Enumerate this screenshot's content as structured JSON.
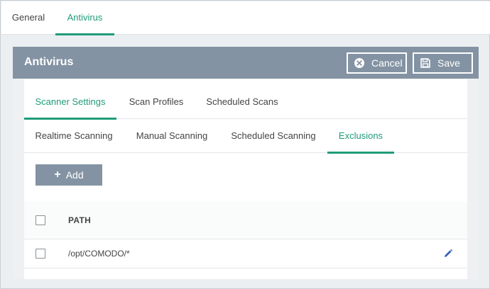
{
  "top_tabs": [
    {
      "label": "General",
      "active": false
    },
    {
      "label": "Antivirus",
      "active": true
    }
  ],
  "panel": {
    "title": "Antivirus",
    "cancel_label": "Cancel",
    "save_label": "Save"
  },
  "main_tabs": [
    {
      "label": "Scanner Settings",
      "active": true
    },
    {
      "label": "Scan Profiles",
      "active": false
    },
    {
      "label": "Scheduled Scans",
      "active": false
    }
  ],
  "sub_tabs": [
    {
      "label": "Realtime Scanning",
      "active": false
    },
    {
      "label": "Manual Scanning",
      "active": false
    },
    {
      "label": "Scheduled Scanning",
      "active": false
    },
    {
      "label": "Exclusions",
      "active": true
    }
  ],
  "add_label": "Add",
  "table": {
    "header_path": "PATH",
    "rows": [
      {
        "path": "/opt/COMODO/*"
      }
    ]
  },
  "colors": {
    "accent": "#1f9c79",
    "header_bg": "#8493a3"
  },
  "icons": {
    "cancel": "cancel-x-circle-icon",
    "save": "save-disk-icon",
    "add": "plus-icon",
    "edit": "pencil-edit-icon"
  }
}
